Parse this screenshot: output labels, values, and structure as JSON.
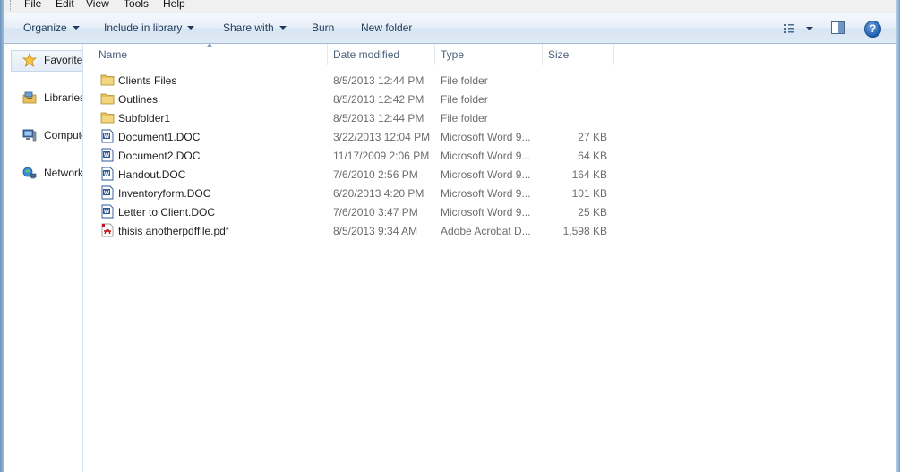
{
  "menu": {
    "items": [
      "File",
      "Edit",
      "View",
      "Tools",
      "Help"
    ]
  },
  "toolbar": {
    "organize": "Organize",
    "include_in_library": "Include in library",
    "share_with": "Share with",
    "burn": "Burn",
    "new_folder": "New folder",
    "help_glyph": "?"
  },
  "nav": {
    "items": [
      {
        "label": "Favorites",
        "icon": "star-icon"
      },
      {
        "label": "Libraries",
        "icon": "libraries-icon"
      },
      {
        "label": "Computer",
        "icon": "computer-icon"
      },
      {
        "label": "Network",
        "icon": "network-icon"
      }
    ]
  },
  "columns": {
    "name": "Name",
    "date": "Date modified",
    "type": "Type",
    "size": "Size"
  },
  "files": [
    {
      "name": "Clients Files",
      "date": "8/5/2013 12:44 PM",
      "type": "File folder",
      "size": "",
      "icon": "folder-icon"
    },
    {
      "name": "Outlines",
      "date": "8/5/2013 12:42 PM",
      "type": "File folder",
      "size": "",
      "icon": "folder-icon"
    },
    {
      "name": "Subfolder1",
      "date": "8/5/2013 12:44 PM",
      "type": "File folder",
      "size": "",
      "icon": "folder-icon"
    },
    {
      "name": "Document1.DOC",
      "date": "3/22/2013 12:04 PM",
      "type": "Microsoft Word 9...",
      "size": "27 KB",
      "icon": "word-doc-icon"
    },
    {
      "name": "Document2.DOC",
      "date": "11/17/2009 2:06 PM",
      "type": "Microsoft Word 9...",
      "size": "64 KB",
      "icon": "word-doc-icon"
    },
    {
      "name": "Handout.DOC",
      "date": "7/6/2010 2:56 PM",
      "type": "Microsoft Word 9...",
      "size": "164 KB",
      "icon": "word-doc-icon"
    },
    {
      "name": "Inventoryform.DOC",
      "date": "6/20/2013 4:20 PM",
      "type": "Microsoft Word 9...",
      "size": "101 KB",
      "icon": "word-doc-icon"
    },
    {
      "name": "Letter to Client.DOC",
      "date": "7/6/2010 3:47 PM",
      "type": "Microsoft Word 9...",
      "size": "25 KB",
      "icon": "word-doc-icon"
    },
    {
      "name": "thisis anotherpdffile.pdf",
      "date": "8/5/2013 9:34 AM",
      "type": "Adobe Acrobat D...",
      "size": "1,598 KB",
      "icon": "pdf-icon"
    }
  ],
  "colors": {
    "toolbar_text": "#1e395b",
    "folder": "#e8c15a",
    "word": "#2b5797",
    "pdf": "#c4161c"
  }
}
